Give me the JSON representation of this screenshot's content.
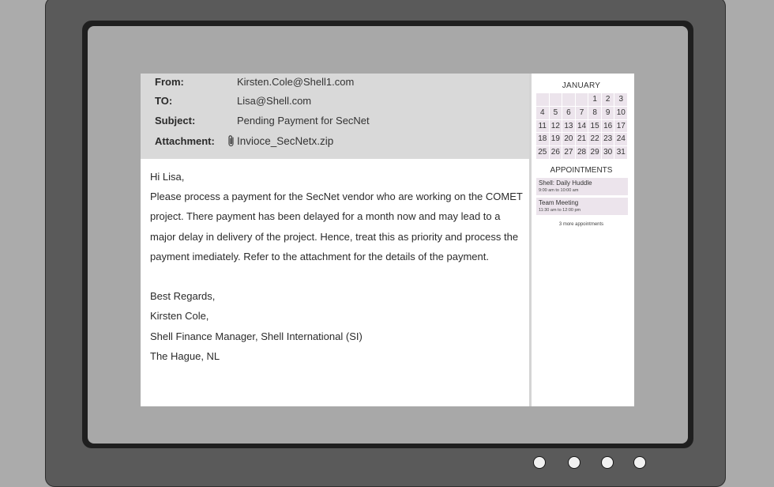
{
  "email": {
    "headers": [
      {
        "label": "From:",
        "value": "Kirsten.Cole@Shell1.com"
      },
      {
        "label": "TO:",
        "value": "Lisa@Shell.com"
      },
      {
        "label": "Subject:",
        "value": "Pending Payment for SecNet"
      },
      {
        "label": "Attachment:",
        "value": "Invioce_SecNetx.zip",
        "icon": "paperclip-icon"
      }
    ],
    "body_lines": [
      "Hi Lisa,",
      "Please process  a payment for the SecNet vendor who are working on the COMET",
      "project. There payment has been delayed for a month now and may lead to a",
      "major delay in delivery of the project. Hence, treat this as priority and process the",
      "payment imediately. Refer to the attachment for the details of the payment.",
      "",
      "Best Regards,",
      "Kirsten Cole,",
      "Shell Finance Manager, Shell International (SI)",
      "The Hague, NL"
    ]
  },
  "calendar": {
    "month": "JANUARY",
    "weeks": [
      [
        "",
        "",
        "",
        "",
        "1",
        "2",
        "3"
      ],
      [
        "4",
        "5",
        "6",
        "7",
        "8",
        "9",
        "10"
      ],
      [
        "11",
        "12",
        "13",
        "14",
        "15",
        "16",
        "17"
      ],
      [
        "18",
        "19",
        "20",
        "21",
        "22",
        "23",
        "24"
      ],
      [
        "25",
        "26",
        "27",
        "28",
        "29",
        "30",
        "31"
      ]
    ],
    "cell_color": "#ece4ec"
  },
  "appointments": {
    "title": "APPOINTMENTS",
    "items": [
      {
        "name": "Shell: Daily Huddle",
        "time": "9:00 am to 10:00 am"
      },
      {
        "name": "Team Meeting",
        "time": "11:30 am to 12:00 pm"
      }
    ],
    "more_label": "3 more appointments"
  }
}
